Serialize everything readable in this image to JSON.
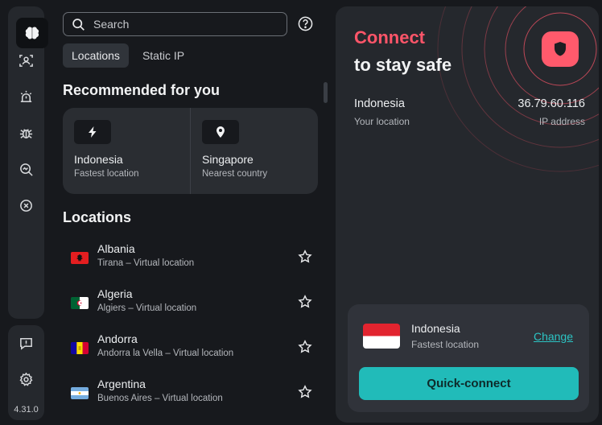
{
  "app": {
    "version": "4.31.0"
  },
  "rail": {
    "items": [
      {
        "icon": "brain-icon",
        "active": true
      },
      {
        "icon": "user-scan-icon"
      },
      {
        "icon": "alarm-icon"
      },
      {
        "icon": "bug-icon"
      },
      {
        "icon": "search-zoom-icon"
      },
      {
        "icon": "block-icon"
      }
    ],
    "bottom": [
      {
        "icon": "feedback-icon"
      },
      {
        "icon": "settings-icon"
      }
    ]
  },
  "search": {
    "placeholder": "Search"
  },
  "tabs": [
    {
      "label": "Locations",
      "active": true
    },
    {
      "label": "Static IP",
      "active": false
    }
  ],
  "recommended": {
    "heading": "Recommended for you",
    "items": [
      {
        "icon": "lightning-icon",
        "name": "Indonesia",
        "sub": "Fastest location"
      },
      {
        "icon": "pin-icon",
        "name": "Singapore",
        "sub": "Nearest country"
      }
    ]
  },
  "locations": {
    "heading": "Locations",
    "items": [
      {
        "name": "Albania",
        "sub": "Tirana – Virtual location",
        "flag": "albania"
      },
      {
        "name": "Algeria",
        "sub": "Algiers – Virtual location",
        "flag": "algeria"
      },
      {
        "name": "Andorra",
        "sub": "Andorra la Vella – Virtual location",
        "flag": "andorra"
      },
      {
        "name": "Argentina",
        "sub": "Buenos Aires – Virtual location",
        "flag": "argentina"
      }
    ]
  },
  "connect": {
    "title": "Connect",
    "subtitle": "to stay safe",
    "country": "Indonesia",
    "country_label": "Your location",
    "ip": "36.79.60.116",
    "ip_label": "IP address"
  },
  "quick_connect": {
    "country": "Indonesia",
    "sub": "Fastest location",
    "change_label": "Change",
    "button_label": "Quick-connect"
  },
  "colors": {
    "accent": "#ff5569",
    "teal": "#21bbb9",
    "bg": "#17191d",
    "panel": "#25282d"
  }
}
